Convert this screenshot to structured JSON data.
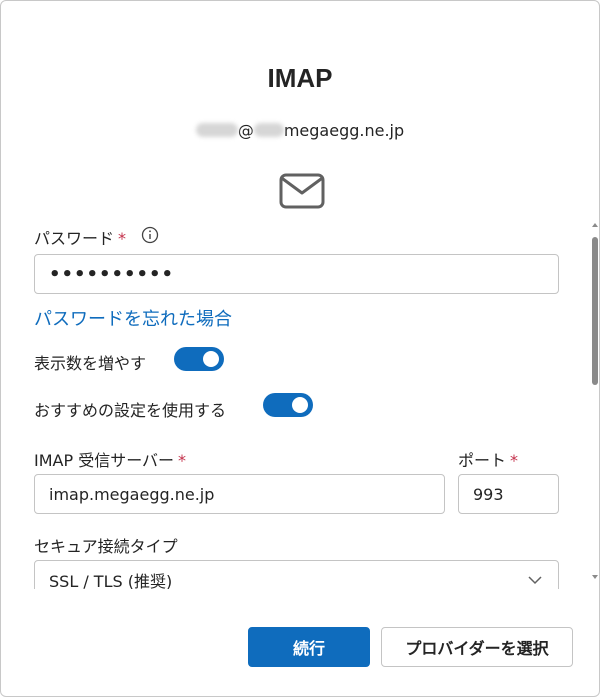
{
  "dialog": {
    "title": "IMAP",
    "account": {
      "domain": "megaegg.ne.jp",
      "at": "@"
    }
  },
  "form": {
    "password_label": "パスワード",
    "required_mark": "*",
    "password_value": "••••••••••",
    "forgot_password_link": "パスワードを忘れた場合",
    "show_more_label": "表示数を増やす",
    "show_more_on": true,
    "recommended_label": "おすすめの設定を使用する",
    "recommended_on": true,
    "imap_server_label": "IMAP 受信サーバー",
    "imap_server_value": "imap.megaegg.ne.jp",
    "port_label": "ポート",
    "port_value": "993",
    "secure_type_label": "セキュア接続タイプ",
    "secure_type_value": "SSL / TLS (推奨)"
  },
  "buttons": {
    "continue_label": "続行",
    "choose_provider_label": "プロバイダーを選択"
  },
  "colors": {
    "accent": "#0f6cbd",
    "required": "#c4314b"
  }
}
